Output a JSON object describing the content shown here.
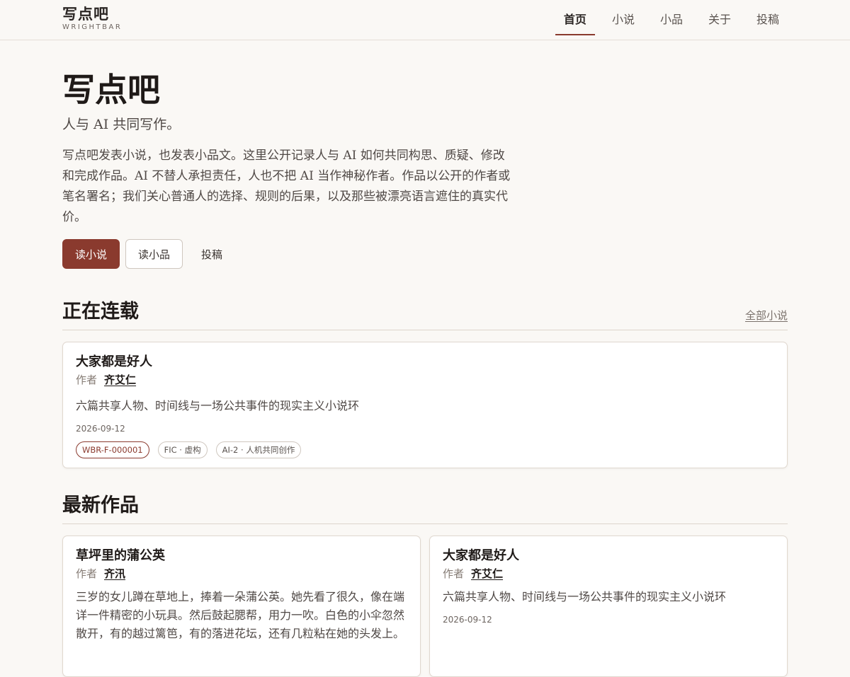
{
  "brand": {
    "name": "写点吧",
    "sub": "WRIGHTBAR"
  },
  "nav": {
    "items": [
      {
        "label": "首页",
        "active": true
      },
      {
        "label": "小说",
        "active": false
      },
      {
        "label": "小品",
        "active": false
      },
      {
        "label": "关于",
        "active": false
      },
      {
        "label": "投稿",
        "active": false
      }
    ]
  },
  "hero": {
    "title": "写点吧",
    "subtitle": "人与 AI 共同写作。",
    "description": "写点吧发表小说，也发表小品文。这里公开记录人与 AI 如何共同构思、质疑、修改和完成作品。AI 不替人承担责任，人也不把 AI 当作神秘作者。作品以公开的作者或笔名署名；我们关心普通人的选择、规则的后果，以及那些被漂亮语言遮住的真实代价。",
    "buttons": {
      "primary": "读小说",
      "secondary": "读小品",
      "text": "投稿"
    }
  },
  "serializing": {
    "title": "正在连载",
    "link": "全部小说",
    "card": {
      "title": "大家都是好人",
      "author_label": "作者",
      "author": "齐艾仁",
      "description": "六篇共享人物、时间线与一场公共事件的现实主义小说环",
      "date": "2026-09-12",
      "tags": [
        "WBR-F-000001",
        "FIC · 虚构",
        "AI-2 · 人机共同创作"
      ]
    }
  },
  "latest": {
    "title": "最新作品",
    "cards": [
      {
        "title": "草坪里的蒲公英",
        "author_label": "作者",
        "author": "齐汛",
        "description": "三岁的女儿蹲在草地上，捧着一朵蒲公英。她先看了很久，像在端详一件精密的小玩具。然后鼓起腮帮，用力一吹。白色的小伞忽然散开，有的越过篱笆，有的落进花坛，还有几粒粘在她的头发上。"
      },
      {
        "title": "大家都是好人",
        "author_label": "作者",
        "author": "齐艾仁",
        "description": "六篇共享人物、时间线与一场公共事件的现实主义小说环",
        "date": "2026-09-12"
      }
    ]
  },
  "colors": {
    "accent": "#8a3a2e",
    "background": "#faf8f5",
    "card": "#ffffff"
  }
}
